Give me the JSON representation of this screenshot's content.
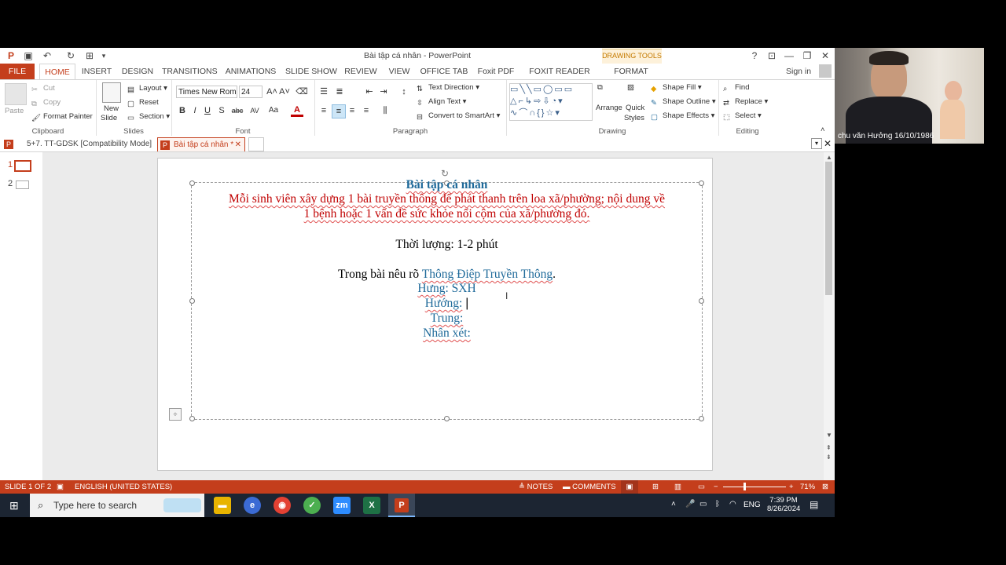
{
  "window": {
    "title": "Bài tập cá nhân - PowerPoint",
    "help": "?",
    "sign_in": "Sign in"
  },
  "ribbon_tabs": [
    "FILE",
    "HOME",
    "INSERT",
    "DESIGN",
    "TRANSITIONS",
    "ANIMATIONS",
    "SLIDE SHOW",
    "REVIEW",
    "VIEW",
    "OFFICE TAB",
    "Foxit PDF",
    "FOXIT READER PDF",
    "FORMAT"
  ],
  "drawing_tools": "DRAWING TOOLS",
  "clipboard": {
    "paste": "Paste",
    "cut": "Cut",
    "copy": "Copy",
    "format_painter": "Format Painter",
    "label": "Clipboard"
  },
  "slides": {
    "new_slide_1": "New",
    "new_slide_2": "Slide",
    "layout": "Layout",
    "reset": "Reset",
    "section": "Section",
    "label": "Slides"
  },
  "font": {
    "name": "Times New Rom",
    "size": "24",
    "label": "Font",
    "bold": "B",
    "italic": "I",
    "underline": "U",
    "shadow": "S",
    "strike": "abc",
    "spacing": "AV",
    "case": "Aa",
    "color": "A"
  },
  "paragraph": {
    "text_direction": "Text Direction",
    "align_text": "Align Text",
    "convert": "Convert to SmartArt",
    "label": "Paragraph"
  },
  "drawing": {
    "arrange": "Arrange",
    "quick_styles_1": "Quick",
    "quick_styles_2": "Styles",
    "shape_fill": "Shape Fill",
    "shape_outline": "Shape Outline",
    "shape_effects": "Shape Effects",
    "label": "Drawing"
  },
  "editing": {
    "find": "Find",
    "replace": "Replace",
    "select": "Select",
    "label": "Editing"
  },
  "doc_tabs": [
    {
      "label": "5+7. TT-GDSK [Compatibility Mode]"
    },
    {
      "label": "Bài tập cá nhân *"
    }
  ],
  "thumbnails": [
    "1",
    "2"
  ],
  "slide_content": {
    "title": "Bài tập cá nhân",
    "line1": "Mỗi sinh viên xây dựng 1 bài truyền thông để phát thanh trên loa xã/phường; nội dung về",
    "line2": "1 bệnh hoặc 1 vấn đề sức khỏe nổi cộm của xã/phường đó.",
    "duration": "Thời lượng: 1-2 phút",
    "intro": "Trong bài nêu rõ ",
    "intro_highlight": "Thông Điệp Truyền Thông",
    "intro_end": ".",
    "hung_label": "Hưng",
    "hung_value": ": SXH",
    "huong": "Hướng:",
    "trung": "Trung:",
    "nhan_xet": "Nhân xét:"
  },
  "status": {
    "slide": "SLIDE 1 OF 2",
    "language": "ENGLISH (UNITED STATES)",
    "notes": "NOTES",
    "comments": "COMMENTS",
    "zoom": "71%"
  },
  "taskbar": {
    "search_placeholder": "Type here to search",
    "lang": "ENG",
    "time": "7:39 PM",
    "date": "8/26/2024"
  },
  "webcam": {
    "name": "chu văn Hưởng 16/10/1986"
  }
}
